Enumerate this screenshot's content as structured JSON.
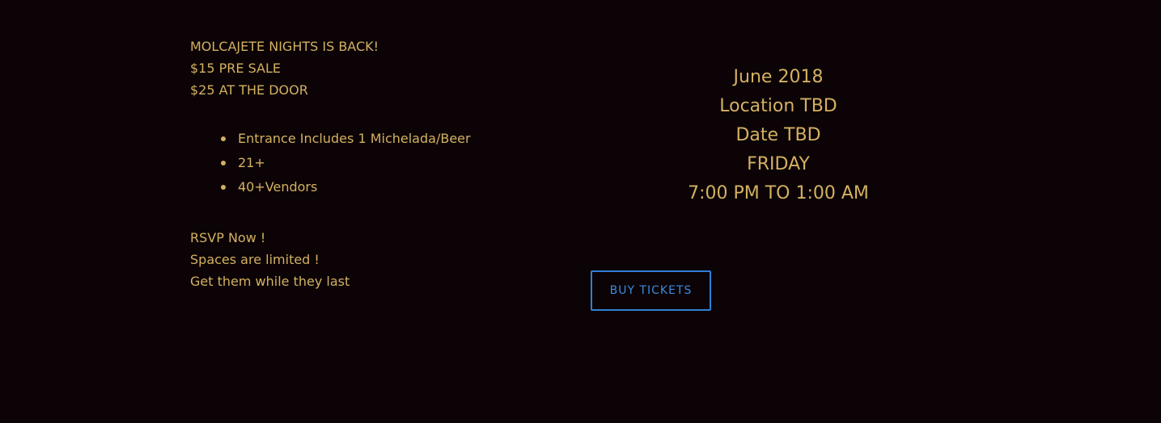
{
  "announcement": {
    "headline": "MOLCAJETE NIGHTS IS BACK!",
    "presale": "$15 PRE SALE",
    "door": "$25 AT THE DOOR"
  },
  "features": [
    "Entrance Includes 1 Michelada/Beer",
    "21+",
    "40+Vendors"
  ],
  "rsvp": {
    "line1": "RSVP Now !",
    "line2": "Spaces are limited !",
    "line3": "Get them while they last"
  },
  "event": {
    "month": "June 2018",
    "location": "Location TBD",
    "date": "Date TBD",
    "day": "FRIDAY",
    "time": "7:00 PM TO 1:00 AM"
  },
  "cta": {
    "label": "BUY TICKETS"
  },
  "colors": {
    "background": "#0b0305",
    "text_gold": "#d4b062",
    "button_blue": "#2f7fd8"
  }
}
